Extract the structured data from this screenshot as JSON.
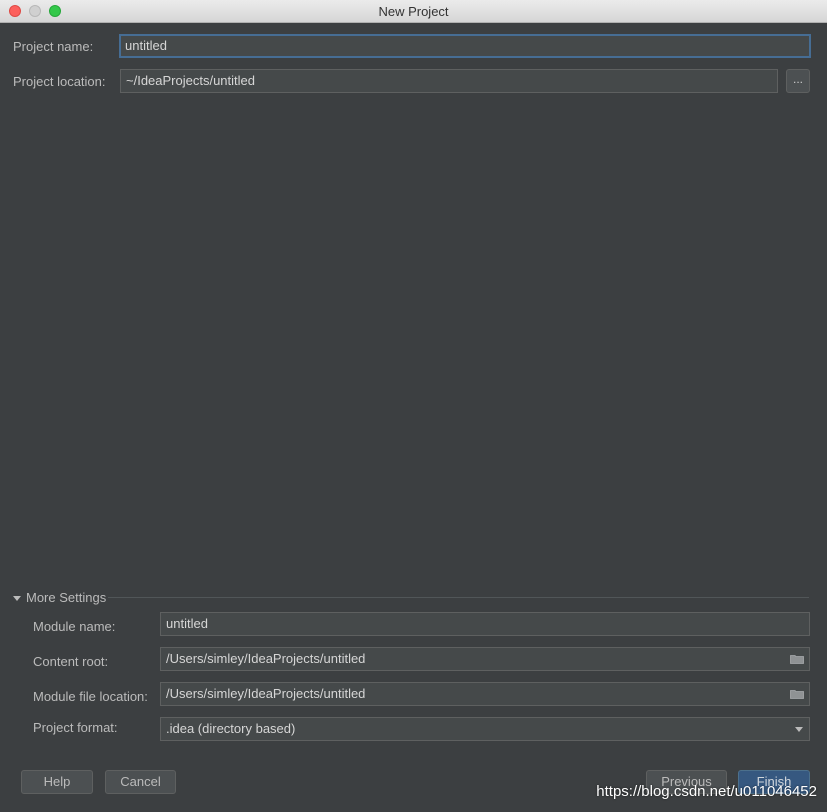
{
  "window": {
    "title": "New Project"
  },
  "project": {
    "name_label": "Project name:",
    "name_value": "untitled",
    "location_label": "Project location:",
    "location_value": "~/IdeaProjects/untitled",
    "browse_label": "..."
  },
  "more_settings": {
    "title": "More Settings",
    "module_name_label": "Module name:",
    "module_name_value": "untitled",
    "content_root_label": "Content root:",
    "content_root_value": "/Users/simley/IdeaProjects/untitled",
    "module_file_label": "Module file location:",
    "module_file_value": "/Users/simley/IdeaProjects/untitled",
    "format_label": "Project format:",
    "format_value": ".idea (directory based)"
  },
  "buttons": {
    "help": "Help",
    "cancel": "Cancel",
    "previous": "Previous",
    "finish": "Finish"
  },
  "watermark": "https://blog.csdn.net/u011046452",
  "colors": {
    "background": "#3c3f41",
    "field": "#45494a",
    "focus_border": "#466d94",
    "primary": "#365880"
  }
}
